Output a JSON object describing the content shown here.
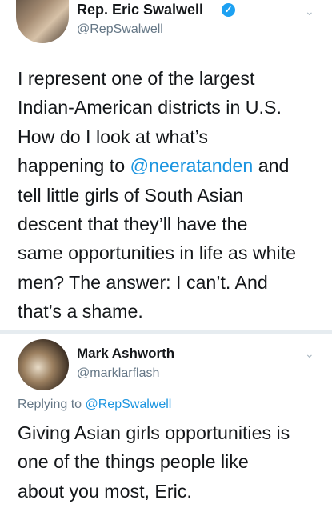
{
  "tweet1": {
    "display_name": "Rep. Eric Swalwell",
    "handle": "@RepSwalwell",
    "verified_glyph": "✓",
    "menu_glyph": "⌄",
    "text": {
      "line1": "I represent one of the largest",
      "line2": "Indian-American districts in U.S.",
      "line3": "How do I look at what’s",
      "line4_pre": "happening to ",
      "line4_mention": "@neeratanden",
      "line4_post": " and",
      "line5": "tell little girls of South Asian",
      "line6": "descent that they’ll have the",
      "line7": "same opportunities in life as white",
      "line8": "men? The answer: I can’t. And",
      "line9": "that’s a shame."
    }
  },
  "tweet2": {
    "display_name": "Mark Ashworth",
    "handle": "@marklarflash",
    "menu_glyph": "⌄",
    "replying_prefix": "Replying to ",
    "replying_handle": "@RepSwalwell",
    "text": {
      "line1": "Giving Asian girls opportunities is",
      "line2": "one of the things people like",
      "line3": "about you most, Eric."
    }
  },
  "colors": {
    "mention": "#1b95e0",
    "secondary_text": "#657786",
    "verified": "#1da1f2",
    "divider": "#e6ecf0"
  },
  "icons": {
    "verified": "verified-badge-icon",
    "menu": "chevron-down-icon"
  }
}
